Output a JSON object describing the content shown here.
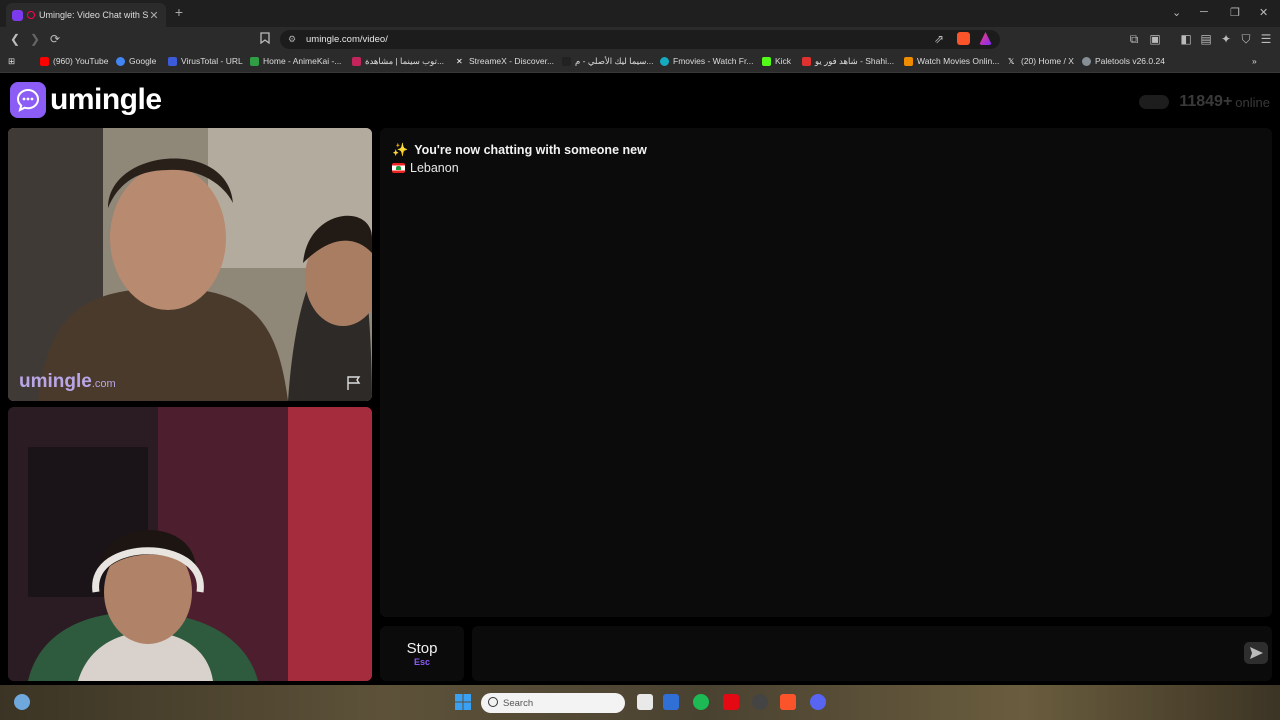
{
  "browser": {
    "tab_title": "Umingle: Video Chat with Strangers",
    "url": "umingle.com/video/",
    "bookmarks": [
      {
        "label": "(960) YouTube",
        "color": "#ff0000"
      },
      {
        "label": "Google",
        "color": "#4285f4"
      },
      {
        "label": "VirusTotal - URL",
        "color": "#3b5bdb"
      },
      {
        "label": "Home - AnimeKai -...",
        "color": "#2f9e44"
      },
      {
        "label": "توب سينما | مشاهدة...",
        "color": "#c2255c"
      },
      {
        "label": "StreameX - Discover...",
        "color": "#ffffff"
      },
      {
        "label": "سيما ليك الأصلي - م...",
        "color": "#222222"
      },
      {
        "label": "Fmovies - Watch Fr...",
        "color": "#15aabf"
      },
      {
        "label": "Kick",
        "color": "#53fc18"
      },
      {
        "label": "شاهد فور يو - Shahi...",
        "color": "#e03131"
      },
      {
        "label": "Watch Movies Onlin...",
        "color": "#f08c00"
      },
      {
        "label": "(20) Home / X",
        "color": "#ffffff"
      },
      {
        "label": "Paletools v26.0.24",
        "color": "#868e96"
      }
    ]
  },
  "site": {
    "logo_text": "umingle",
    "brand_color": "#8b5cf6",
    "online_count": "11849+",
    "online_label": "online",
    "watermark_name": "umingle",
    "watermark_domain": ".com"
  },
  "chat": {
    "status_message": "You're now chatting with someone new",
    "country": "Lebanon",
    "input_value": "",
    "input_placeholder": ""
  },
  "controls": {
    "stop_label": "Stop",
    "stop_key": "Esc"
  },
  "taskbar": {
    "search_placeholder": "Search"
  }
}
